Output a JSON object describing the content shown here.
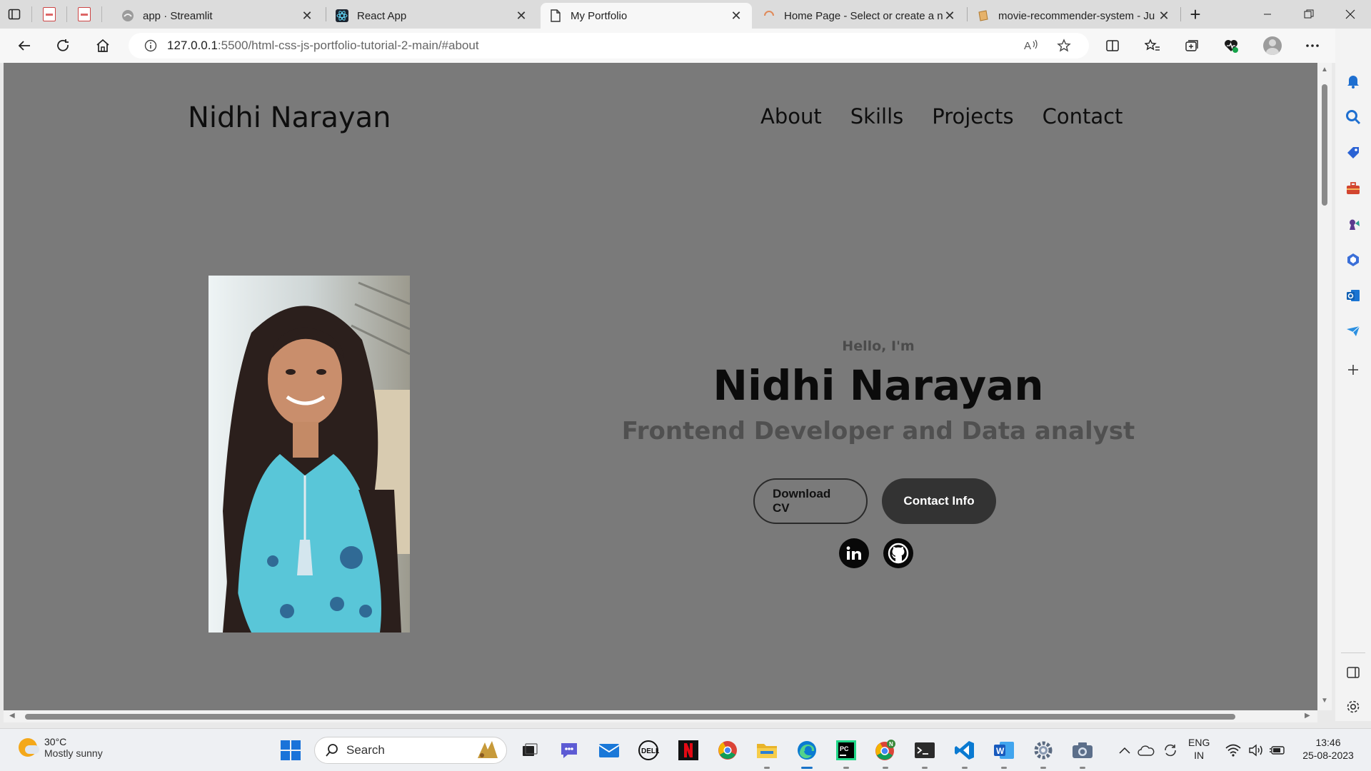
{
  "browser": {
    "tabs": [
      {
        "title": "app · Streamlit",
        "active": false
      },
      {
        "title": "React App",
        "active": false
      },
      {
        "title": "My Portfolio",
        "active": true
      },
      {
        "title": "Home Page - Select or create a n",
        "active": false
      },
      {
        "title": "movie-recommender-system - Ju",
        "active": false
      }
    ],
    "url_host": "127.0.0.1",
    "url_path": ":5500/html-css-js-portfolio-tutorial-2-main/#about",
    "new_tab": "+"
  },
  "page": {
    "logo": "Nidhi Narayan",
    "nav": [
      "About",
      "Skills",
      "Projects",
      "Contact"
    ],
    "hello": "Hello, I'm",
    "name": "Nidhi Narayan",
    "role": "Frontend Developer and Data analyst",
    "download_cv": "Download CV",
    "contact_info": "Contact Info",
    "background_color": "#7a7a7a"
  },
  "taskbar": {
    "temp": "30°C",
    "weather": "Mostly sunny",
    "search_placeholder": "Search",
    "lang1": "ENG",
    "lang2": "IN",
    "time": "13:46",
    "date": "25-08-2023"
  }
}
